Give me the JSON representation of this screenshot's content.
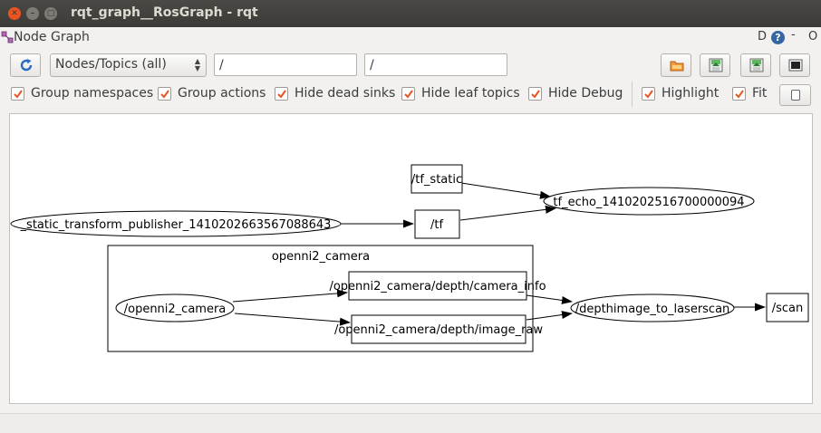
{
  "window": {
    "title": "rqt_graph__RosGraph - rqt"
  },
  "plugin": {
    "title": "Node Graph",
    "header_d": "D",
    "header_help": "?",
    "header_dash": "-",
    "header_o": "O"
  },
  "toolbar": {
    "mode_selected": "Nodes/Topics (all)",
    "filter_include": "/",
    "filter_exclude": "/",
    "icons": [
      "refresh-icon",
      "open-folder-icon",
      "save-dot-icon",
      "save-svg-icon",
      "screenshot-icon"
    ]
  },
  "options": [
    {
      "label": "Group namespaces",
      "checked": true
    },
    {
      "label": "Group actions",
      "checked": true
    },
    {
      "label": "Hide dead sinks",
      "checked": true
    },
    {
      "label": "Hide leaf topics",
      "checked": true
    },
    {
      "label": "Hide Debug",
      "checked": true
    },
    {
      "label": "Highlight",
      "checked": true
    },
    {
      "label": "Fit",
      "checked": true
    }
  ],
  "graph": {
    "namespace_label": "openni2_camera",
    "nodes": {
      "static_tf_pub": "_static_transform_publisher_1410202663567088643",
      "tf_echo": "tf_echo_1410202516700000094",
      "openni2_camera": "/openni2_camera",
      "depthimage_to_laserscan": "/depthimage_to_laserscan"
    },
    "topics": {
      "tf_static": "/tf_static",
      "tf": "/tf",
      "camera_info": "/openni2_camera/depth/camera_info",
      "image_raw": "/openni2_camera/depth/image_raw",
      "scan": "/scan"
    }
  },
  "colors": {
    "titlebar": "#3c3b37",
    "close_button": "#e9541f",
    "checkbox_accent": "#e95420"
  }
}
